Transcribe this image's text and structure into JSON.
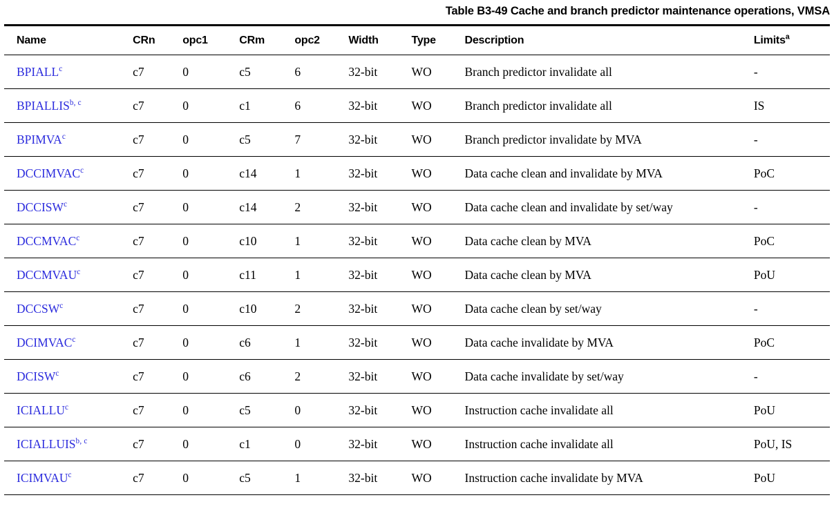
{
  "caption": "Table B3-49 Cache and branch predictor maintenance operations, VMSA",
  "columns": {
    "name": "Name",
    "crn": "CRn",
    "opc1": "opc1",
    "crm": "CRm",
    "opc2": "opc2",
    "width": "Width",
    "type": "Type",
    "description": "Description",
    "limits": "Limits",
    "limits_footnote": "a"
  },
  "colors": {
    "register_link": "#2b2bdd",
    "rule": "#000000",
    "text": "#000000"
  },
  "rows": [
    {
      "name": "BPIALL",
      "name_footnote": "c",
      "crn": "c7",
      "opc1": "0",
      "crm": "c5",
      "opc2": "6",
      "width": "32-bit",
      "type": "WO",
      "description": "Branch predictor invalidate all",
      "limits": "-"
    },
    {
      "name": "BPIALLIS",
      "name_footnote": "b, c",
      "crn": "c7",
      "opc1": "0",
      "crm": "c1",
      "opc2": "6",
      "width": "32-bit",
      "type": "WO",
      "description": "Branch predictor invalidate all",
      "limits": "IS"
    },
    {
      "name": "BPIMVA",
      "name_footnote": "c",
      "crn": "c7",
      "opc1": "0",
      "crm": "c5",
      "opc2": "7",
      "width": "32-bit",
      "type": "WO",
      "description": "Branch predictor invalidate by MVA",
      "limits": "-"
    },
    {
      "name": "DCCIMVAC",
      "name_footnote": "c",
      "crn": "c7",
      "opc1": "0",
      "crm": "c14",
      "opc2": "1",
      "width": "32-bit",
      "type": "WO",
      "description": "Data cache clean and invalidate by MVA",
      "limits": "PoC"
    },
    {
      "name": "DCCISW",
      "name_footnote": "c",
      "crn": "c7",
      "opc1": "0",
      "crm": "c14",
      "opc2": "2",
      "width": "32-bit",
      "type": "WO",
      "description": "Data cache clean and invalidate by set/way",
      "limits": "-"
    },
    {
      "name": "DCCMVAC",
      "name_footnote": "c",
      "crn": "c7",
      "opc1": "0",
      "crm": "c10",
      "opc2": "1",
      "width": "32-bit",
      "type": "WO",
      "description": "Data cache clean by MVA",
      "limits": "PoC"
    },
    {
      "name": "DCCMVAU",
      "name_footnote": "c",
      "crn": "c7",
      "opc1": "0",
      "crm": "c11",
      "opc2": "1",
      "width": "32-bit",
      "type": "WO",
      "description": "Data cache clean by MVA",
      "limits": "PoU"
    },
    {
      "name": "DCCSW",
      "name_footnote": "c",
      "crn": "c7",
      "opc1": "0",
      "crm": "c10",
      "opc2": "2",
      "width": "32-bit",
      "type": "WO",
      "description": "Data cache clean by set/way",
      "limits": "-"
    },
    {
      "name": "DCIMVAC",
      "name_footnote": "c",
      "crn": "c7",
      "opc1": "0",
      "crm": "c6",
      "opc2": "1",
      "width": "32-bit",
      "type": "WO",
      "description": "Data cache invalidate by MVA",
      "limits": "PoC"
    },
    {
      "name": "DCISW",
      "name_footnote": "c",
      "crn": "c7",
      "opc1": "0",
      "crm": "c6",
      "opc2": "2",
      "width": "32-bit",
      "type": "WO",
      "description": "Data cache invalidate by set/way",
      "limits": "-"
    },
    {
      "name": "ICIALLU",
      "name_footnote": "c",
      "crn": "c7",
      "opc1": "0",
      "crm": "c5",
      "opc2": "0",
      "width": "32-bit",
      "type": "WO",
      "description": "Instruction cache invalidate all",
      "limits": "PoU"
    },
    {
      "name": "ICIALLUIS",
      "name_footnote": "b, c",
      "crn": "c7",
      "opc1": "0",
      "crm": "c1",
      "opc2": "0",
      "width": "32-bit",
      "type": "WO",
      "description": "Instruction cache invalidate all",
      "limits": "PoU, IS"
    },
    {
      "name": "ICIMVAU",
      "name_footnote": "c",
      "crn": "c7",
      "opc1": "0",
      "crm": "c5",
      "opc2": "1",
      "width": "32-bit",
      "type": "WO",
      "description": "Instruction cache invalidate by MVA",
      "limits": "PoU"
    }
  ]
}
